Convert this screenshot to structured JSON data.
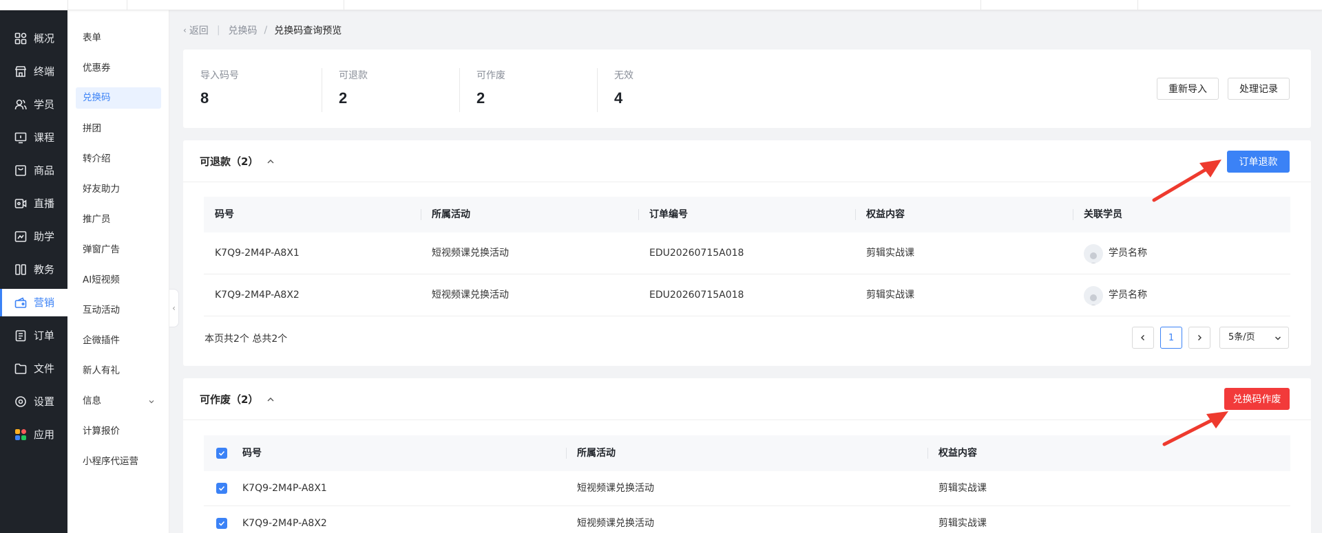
{
  "rail": {
    "items": [
      {
        "label": "概况",
        "icon": "dashboard-icon"
      },
      {
        "label": "终端",
        "icon": "store-icon"
      },
      {
        "label": "学员",
        "icon": "users-icon"
      },
      {
        "label": "课程",
        "icon": "course-icon"
      },
      {
        "label": "商品",
        "icon": "shopping-bag-icon"
      },
      {
        "label": "直播",
        "icon": "live-icon"
      },
      {
        "label": "助学",
        "icon": "study-icon"
      },
      {
        "label": "教务",
        "icon": "book-icon"
      },
      {
        "label": "营销",
        "icon": "marketing-icon",
        "active": true
      },
      {
        "label": "订单",
        "icon": "order-icon"
      },
      {
        "label": "文件",
        "icon": "folder-icon"
      },
      {
        "label": "设置",
        "icon": "settings-icon"
      },
      {
        "label": "应用",
        "icon": "apps-icon"
      }
    ]
  },
  "subnav": {
    "items": [
      {
        "label": "表单"
      },
      {
        "label": "优惠券"
      },
      {
        "label": "兑换码",
        "active": true
      },
      {
        "label": "拼团"
      },
      {
        "label": "转介绍"
      },
      {
        "label": "好友助力"
      },
      {
        "label": "推广员"
      },
      {
        "label": "弹窗广告"
      },
      {
        "label": "AI短视频"
      },
      {
        "label": "互动活动"
      },
      {
        "label": "企微插件"
      },
      {
        "label": "新人有礼"
      },
      {
        "label": "信息",
        "has_children": true
      },
      {
        "label": "计算报价"
      },
      {
        "label": "小程序代运营"
      }
    ]
  },
  "breadcrumb": {
    "back": "返回",
    "parent": "兑换码",
    "separator": "/",
    "current": "兑换码查询预览"
  },
  "summary": {
    "stats": [
      {
        "label": "导入码号",
        "value": "8"
      },
      {
        "label": "可退款",
        "value": "2"
      },
      {
        "label": "可作废",
        "value": "2"
      },
      {
        "label": "无效",
        "value": "4"
      }
    ],
    "reimport_label": "重新导入",
    "records_label": "处理记录"
  },
  "refundable": {
    "title": "可退款（2）",
    "action_label": "订单退款",
    "columns": [
      "码号",
      "所属活动",
      "订单编号",
      "权益内容",
      "关联学员"
    ],
    "rows": [
      {
        "code": "K7Q9-2M4P-A8X1",
        "activity": "短视频课兑换活动",
        "order": "EDU20260715A018",
        "benefit": "剪辑实战课",
        "student": "学员名称"
      },
      {
        "code": "K7Q9-2M4P-A8X2",
        "activity": "短视频课兑换活动",
        "order": "EDU20260715A018",
        "benefit": "剪辑实战课",
        "student": "学员名称"
      }
    ],
    "pager": {
      "info": "本页共2个  总共2个",
      "current_page": "1",
      "page_size": "5条/页"
    }
  },
  "voidable": {
    "title": "可作废（2）",
    "action_label": "兑换码作废",
    "columns": [
      "码号",
      "所属活动",
      "权益内容"
    ],
    "rows": [
      {
        "code": "K7Q9-2M4P-A8X1",
        "activity": "短视频课兑换活动",
        "benefit": "剪辑实战课"
      },
      {
        "code": "K7Q9-2M4P-A8X2",
        "activity": "短视频课兑换活动",
        "benefit": "剪辑实战课"
      }
    ]
  },
  "colors": {
    "primary": "#3b82f6",
    "danger": "#f23a3a",
    "rail_bg": "#1f2329",
    "annotation_arrow": "#ee3a2e"
  }
}
